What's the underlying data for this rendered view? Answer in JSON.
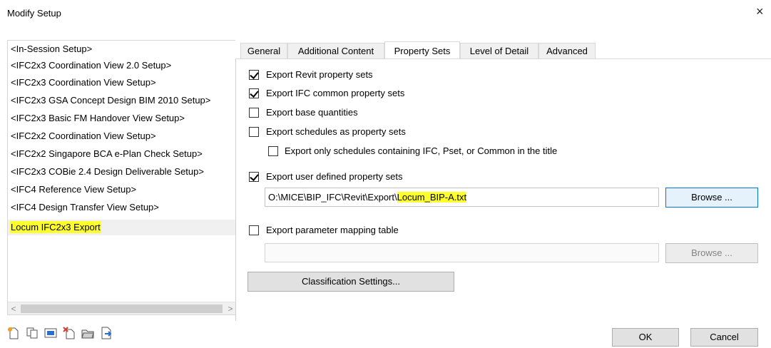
{
  "window": {
    "title": "Modify Setup",
    "close_glyph": "×"
  },
  "setups": {
    "items": [
      "<In-Session Setup>",
      "<IFC2x3 Coordination View 2.0 Setup>",
      "<IFC2x3 Coordination View Setup>",
      "<IFC2x3 GSA Concept Design BIM 2010 Setup>",
      "<IFC2x3 Basic FM Handover View Setup>",
      "<IFC2x2 Coordination View Setup>",
      "<IFC2x2 Singapore BCA e-Plan Check Setup>",
      "<IFC2x3 COBie 2.4 Design Deliverable Setup>",
      "<IFC4 Reference View Setup>",
      "<IFC4 Design Transfer View Setup>",
      "Locum IFC2x3 Export"
    ],
    "selected_index": 10,
    "scroll_left": "<",
    "scroll_right": ">"
  },
  "tabs": [
    "General",
    "Additional Content",
    "Property Sets",
    "Level of Detail",
    "Advanced"
  ],
  "active_tab": "Property Sets",
  "property_sets": {
    "export_revit": {
      "label": "Export Revit property sets",
      "checked": true
    },
    "export_ifc_common": {
      "label": "Export IFC common property sets",
      "checked": true
    },
    "export_base_quantities": {
      "label": "Export base quantities",
      "checked": false
    },
    "export_schedules": {
      "label": "Export schedules as property sets",
      "checked": false
    },
    "export_schedules_filtered": {
      "label": "Export only schedules containing IFC, Pset, or Common in the title",
      "checked": false
    },
    "export_user_defined": {
      "label": "Export user defined property sets",
      "checked": true
    },
    "user_defined_path_prefix": "O:\\MICE\\BIP_IFC\\Revit\\Export\\",
    "user_defined_path_file": "Locum_BIP-A.txt",
    "browse_label": "Browse ...",
    "export_param_mapping": {
      "label": "Export parameter mapping table",
      "checked": false
    },
    "param_mapping_path": "",
    "browse_disabled_label": "Browse ...",
    "classification_label": "Classification Settings..."
  },
  "footer": {
    "ok_label": "OK",
    "cancel_label": "Cancel"
  },
  "icons": [
    "new-setup-icon",
    "duplicate-setup-icon",
    "rename-setup-icon",
    "delete-setup-icon",
    "import-setup-icon",
    "export-setup-icon"
  ],
  "colors": {
    "highlight": "#ffff2e",
    "accent": "#0078d7",
    "icon_orange": "#f0a020",
    "icon_blue": "#2a6fc9",
    "icon_red": "#d83a2e"
  }
}
